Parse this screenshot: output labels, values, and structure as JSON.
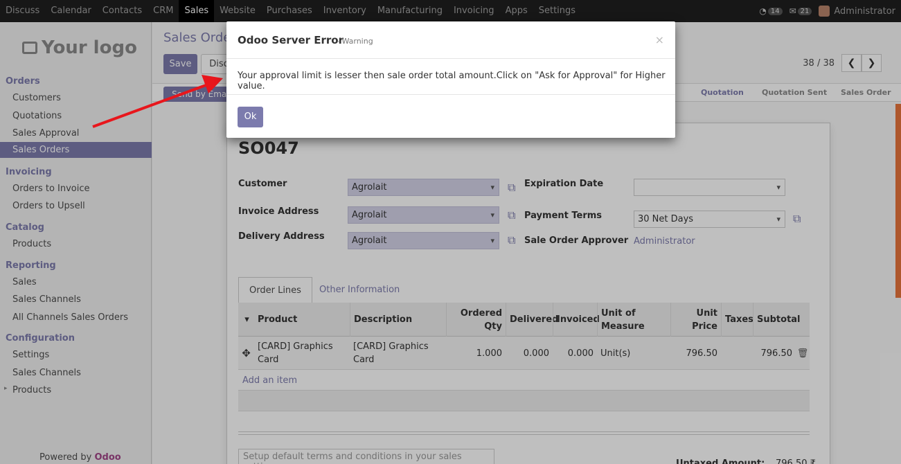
{
  "topnav": {
    "items": [
      "Discuss",
      "Calendar",
      "Contacts",
      "CRM",
      "Sales",
      "Website",
      "Purchases",
      "Inventory",
      "Manufacturing",
      "Invoicing",
      "Apps",
      "Settings"
    ],
    "active": "Sales",
    "msg_count": "14",
    "chat_count": "21",
    "user": "Administrator"
  },
  "sidebar": {
    "logo_text": "Your logo",
    "sections": [
      {
        "title": "Orders",
        "items": [
          "Customers",
          "Quotations",
          "Sales Approval",
          "Sales Orders"
        ]
      },
      {
        "title": "Invoicing",
        "items": [
          "Orders to Invoice",
          "Orders to Upsell"
        ]
      },
      {
        "title": "Catalog",
        "items": [
          "Products"
        ]
      },
      {
        "title": "Reporting",
        "items": [
          "Sales",
          "Sales Channels",
          "All Channels Sales Orders"
        ]
      },
      {
        "title": "Configuration",
        "items": [
          "Settings",
          "Sales Channels",
          "Products"
        ]
      }
    ],
    "active_item": "Sales Orders",
    "powered_prefix": "Powered by ",
    "powered_brand": "Odoo"
  },
  "main": {
    "title": "Sales Orde",
    "save_label": "Save",
    "discard_label": "Disca",
    "send_email_label": "Send by Email",
    "pager": "38 / 38",
    "stages": [
      "Quotation",
      "Quotation Sent",
      "Sales Order"
    ],
    "current_stage": "Quotation"
  },
  "form": {
    "name": "SO047",
    "customer_label": "Customer",
    "customer_value": "Agrolait",
    "invoice_address_label": "Invoice Address",
    "invoice_address_value": "Agrolait",
    "delivery_address_label": "Delivery Address",
    "delivery_address_value": "Agrolait",
    "expiration_date_label": "Expiration Date",
    "expiration_date_value": "",
    "payment_terms_label": "Payment Terms",
    "payment_terms_value": "30 Net Days",
    "approver_label": "Sale Order Approver",
    "approver_value": "Administrator",
    "tabs": [
      "Order Lines",
      "Other Information"
    ],
    "columns": [
      "Product",
      "Description",
      "Ordered Qty",
      "Delivered",
      "Invoiced",
      "Unit of Measure",
      "Unit Price",
      "Taxes",
      "Subtotal"
    ],
    "lines": [
      {
        "product": "[CARD] Graphics Card",
        "description": "[CARD] Graphics Card",
        "ordered_qty": "1.000",
        "delivered": "0.000",
        "invoiced": "0.000",
        "uom": "Unit(s)",
        "unit_price": "796.50",
        "taxes": "",
        "subtotal": "796.50"
      }
    ],
    "add_item": "Add an item",
    "terms_placeholder": "Setup default terms and conditions in your sales settings ...",
    "untaxed_label": "Untaxed Amount:",
    "untaxed_value": "796.50 ₹"
  },
  "dialog": {
    "title": "Odoo Server Error",
    "subtitle": "- Warning",
    "close": "×",
    "message": "Your approval limit is lesser then sale order total amount.Click on \"Ask for Approval\" for Higher value.",
    "ok_label": "Ok"
  },
  "colors": {
    "brand": "#7c7bad",
    "topbar": "#1f1f1f",
    "arrow": "#e8161c"
  }
}
